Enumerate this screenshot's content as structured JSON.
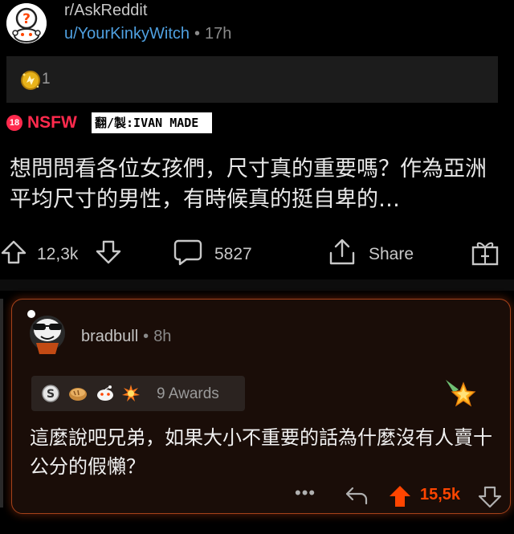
{
  "header": {
    "subreddit": "r/AskReddit",
    "username": "u/YourKinkyWitch",
    "separator": "•",
    "time": "17h",
    "avatar_icon": "question-mark-snoo-icon"
  },
  "awards_bar": {
    "icon": "gold-award-icon",
    "count": "1"
  },
  "tags": {
    "nsfw_badge": "18",
    "nsfw_label": "NSFW",
    "credit": "翻/製:IVAN MADE",
    "nsfw_color": "#ff2a4d"
  },
  "post": {
    "title": "想問問看各位女孩們，尺寸真的重要嗎？作為亞洲平均尺寸的男性，有時候真的挺自卑的…"
  },
  "actions": {
    "upvote_icon": "upvote-arrow-icon",
    "score": "12,3k",
    "downvote_icon": "downvote-arrow-icon",
    "comments_icon": "comment-bubble-icon",
    "comments": "5827",
    "share_icon": "share-icon",
    "share_label": "Share",
    "gift_icon": "gift-award-icon"
  },
  "comment": {
    "username": "bradbull",
    "separator": "•",
    "time": "8h",
    "awards_label": "9 Awards",
    "award_icons": [
      "silver-award-icon",
      "bread-award-icon",
      "snoo-award-icon",
      "burst-award-icon"
    ],
    "star_icon": "shooting-star-award-icon",
    "text": "這麼說吧兄弟，如果大小不重要的話為什麼沒有人賣十公分的假懶？",
    "more": "•••",
    "score": "15,5k",
    "score_color": "#ff4500",
    "border_color": "#a5421a"
  }
}
